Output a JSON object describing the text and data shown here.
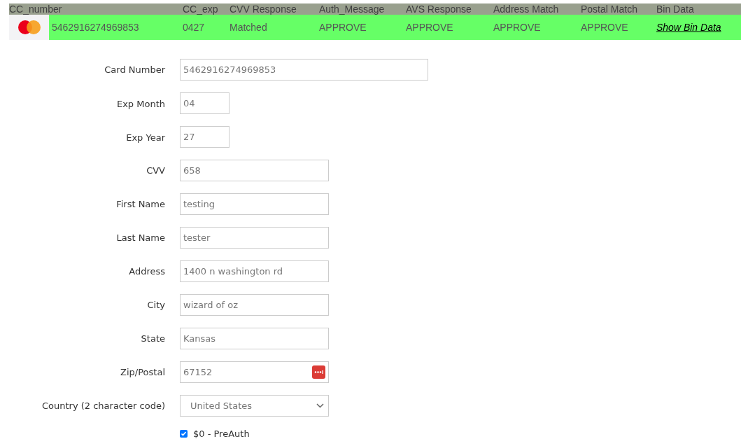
{
  "table": {
    "columns": [
      "CC_number",
      "CC_exp",
      "CVV Response",
      "Auth_Message",
      "AVS Response",
      "Address Match",
      "Postal Match",
      "Bin Data"
    ],
    "rows": [
      {
        "cc_number": "5462916274969853",
        "cc_exp": "0427",
        "cvv_response": "Matched",
        "auth_message": "APPROVE",
        "avs_response": "APPROVE",
        "address_match": "APPROVE",
        "postal_match": "APPROVE",
        "bin_data": "Show Bin Data"
      }
    ]
  },
  "form": {
    "fields": [
      {
        "label": "Card Number",
        "value": "5462916274969853",
        "kind": "wide"
      },
      {
        "label": "Exp Month",
        "value": "04",
        "kind": "short"
      },
      {
        "label": "Exp Year",
        "value": "27",
        "kind": "short"
      },
      {
        "label": "CVV",
        "value": "658",
        "kind": "medium"
      },
      {
        "label": "First Name",
        "value": "testing",
        "kind": "medium"
      },
      {
        "label": "Last Name",
        "value": "tester",
        "kind": "medium"
      },
      {
        "label": "Address",
        "value": "1400 n washington rd",
        "kind": "medium"
      },
      {
        "label": "City",
        "value": "wizard of oz",
        "kind": "medium"
      },
      {
        "label": "State",
        "value": "Kansas",
        "kind": "medium"
      },
      {
        "label": "Zip/Postal",
        "value": "67152",
        "kind": "password-manager"
      },
      {
        "label": "Country (2 character code)",
        "value": "United States",
        "kind": "select"
      }
    ],
    "checkbox": {
      "label": "$0 - PreAuth",
      "checked": true
    }
  }
}
